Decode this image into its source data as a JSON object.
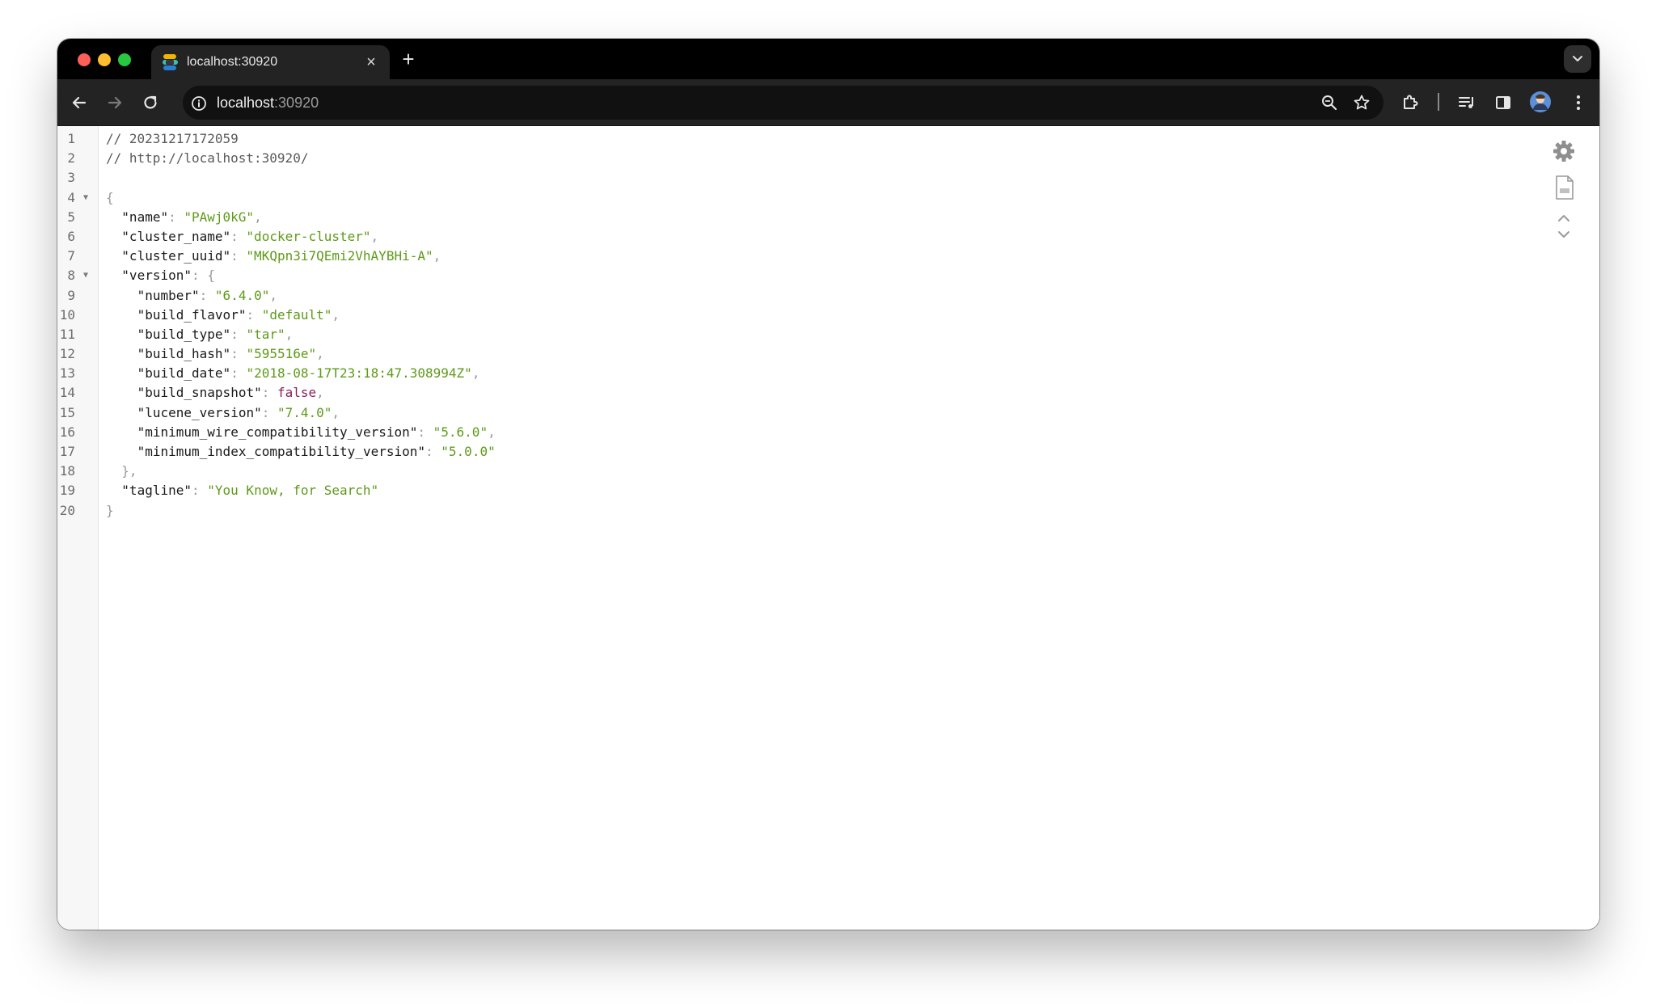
{
  "browser": {
    "tab_title": "localhost:30920",
    "tab_close_label": "×",
    "new_tab_label": "+",
    "url_host": "localhost",
    "url_port": ":30920"
  },
  "icons": {
    "traffic_lights": [
      "close-window-icon",
      "minimize-window-icon",
      "maximize-window-icon"
    ],
    "toolbar": [
      "back-arrow-icon",
      "forward-arrow-icon",
      "reload-icon",
      "site-info-icon",
      "zoom-icon",
      "bookmark-star-icon",
      "extensions-icon",
      "media-control-icon",
      "side-panel-icon",
      "profile-avatar",
      "more-menu-icon"
    ],
    "viewer": [
      "settings-gear-icon",
      "raw-file-icon",
      "collapse-toggle-icon"
    ]
  },
  "colors": {
    "string": "#5e9a18",
    "boolean": "#8b1f5a",
    "comment": "#5a5a5a"
  },
  "json_viewer": {
    "lines": [
      {
        "n": "1",
        "parts": [
          {
            "t": "// 20231217172059",
            "c": "comment"
          }
        ]
      },
      {
        "n": "2",
        "parts": [
          {
            "t": "// http://localhost:30920/",
            "c": "comment"
          }
        ]
      },
      {
        "n": "3",
        "parts": []
      },
      {
        "n": "4",
        "fold": true,
        "parts": [
          {
            "t": "{",
            "c": "punc"
          }
        ]
      },
      {
        "n": "5",
        "indent": 1,
        "parts": [
          {
            "t": "\"name\"",
            "c": "key"
          },
          {
            "t": ": ",
            "c": "punc"
          },
          {
            "t": "\"PAwj0kG\"",
            "c": "str"
          },
          {
            "t": ",",
            "c": "punc"
          }
        ]
      },
      {
        "n": "6",
        "indent": 1,
        "parts": [
          {
            "t": "\"cluster_name\"",
            "c": "key"
          },
          {
            "t": ": ",
            "c": "punc"
          },
          {
            "t": "\"docker-cluster\"",
            "c": "str"
          },
          {
            "t": ",",
            "c": "punc"
          }
        ]
      },
      {
        "n": "7",
        "indent": 1,
        "parts": [
          {
            "t": "\"cluster_uuid\"",
            "c": "key"
          },
          {
            "t": ": ",
            "c": "punc"
          },
          {
            "t": "\"MKQpn3i7QEmi2VhAYBHi-A\"",
            "c": "str"
          },
          {
            "t": ",",
            "c": "punc"
          }
        ]
      },
      {
        "n": "8",
        "indent": 1,
        "fold": true,
        "parts": [
          {
            "t": "\"version\"",
            "c": "key"
          },
          {
            "t": ": {",
            "c": "punc"
          }
        ]
      },
      {
        "n": "9",
        "indent": 2,
        "parts": [
          {
            "t": "\"number\"",
            "c": "key"
          },
          {
            "t": ": ",
            "c": "punc"
          },
          {
            "t": "\"6.4.0\"",
            "c": "str"
          },
          {
            "t": ",",
            "c": "punc"
          }
        ]
      },
      {
        "n": "10",
        "indent": 2,
        "parts": [
          {
            "t": "\"build_flavor\"",
            "c": "key"
          },
          {
            "t": ": ",
            "c": "punc"
          },
          {
            "t": "\"default\"",
            "c": "str"
          },
          {
            "t": ",",
            "c": "punc"
          }
        ]
      },
      {
        "n": "11",
        "indent": 2,
        "parts": [
          {
            "t": "\"build_type\"",
            "c": "key"
          },
          {
            "t": ": ",
            "c": "punc"
          },
          {
            "t": "\"tar\"",
            "c": "str"
          },
          {
            "t": ",",
            "c": "punc"
          }
        ]
      },
      {
        "n": "12",
        "indent": 2,
        "parts": [
          {
            "t": "\"build_hash\"",
            "c": "key"
          },
          {
            "t": ": ",
            "c": "punc"
          },
          {
            "t": "\"595516e\"",
            "c": "str"
          },
          {
            "t": ",",
            "c": "punc"
          }
        ]
      },
      {
        "n": "13",
        "indent": 2,
        "parts": [
          {
            "t": "\"build_date\"",
            "c": "key"
          },
          {
            "t": ": ",
            "c": "punc"
          },
          {
            "t": "\"2018-08-17T23:18:47.308994Z\"",
            "c": "str"
          },
          {
            "t": ",",
            "c": "punc"
          }
        ]
      },
      {
        "n": "14",
        "indent": 2,
        "parts": [
          {
            "t": "\"build_snapshot\"",
            "c": "key"
          },
          {
            "t": ": ",
            "c": "punc"
          },
          {
            "t": "false",
            "c": "bool"
          },
          {
            "t": ",",
            "c": "punc"
          }
        ]
      },
      {
        "n": "15",
        "indent": 2,
        "parts": [
          {
            "t": "\"lucene_version\"",
            "c": "key"
          },
          {
            "t": ": ",
            "c": "punc"
          },
          {
            "t": "\"7.4.0\"",
            "c": "str"
          },
          {
            "t": ",",
            "c": "punc"
          }
        ]
      },
      {
        "n": "16",
        "indent": 2,
        "parts": [
          {
            "t": "\"minimum_wire_compatibility_version\"",
            "c": "key"
          },
          {
            "t": ": ",
            "c": "punc"
          },
          {
            "t": "\"5.6.0\"",
            "c": "str"
          },
          {
            "t": ",",
            "c": "punc"
          }
        ]
      },
      {
        "n": "17",
        "indent": 2,
        "parts": [
          {
            "t": "\"minimum_index_compatibility_version\"",
            "c": "key"
          },
          {
            "t": ": ",
            "c": "punc"
          },
          {
            "t": "\"5.0.0\"",
            "c": "str"
          }
        ]
      },
      {
        "n": "18",
        "indent": 1,
        "parts": [
          {
            "t": "},",
            "c": "punc"
          }
        ]
      },
      {
        "n": "19",
        "indent": 1,
        "parts": [
          {
            "t": "\"tagline\"",
            "c": "key"
          },
          {
            "t": ": ",
            "c": "punc"
          },
          {
            "t": "\"You Know, for Search\"",
            "c": "str"
          }
        ]
      },
      {
        "n": "20",
        "parts": [
          {
            "t": "}",
            "c": "punc"
          }
        ]
      }
    ]
  }
}
